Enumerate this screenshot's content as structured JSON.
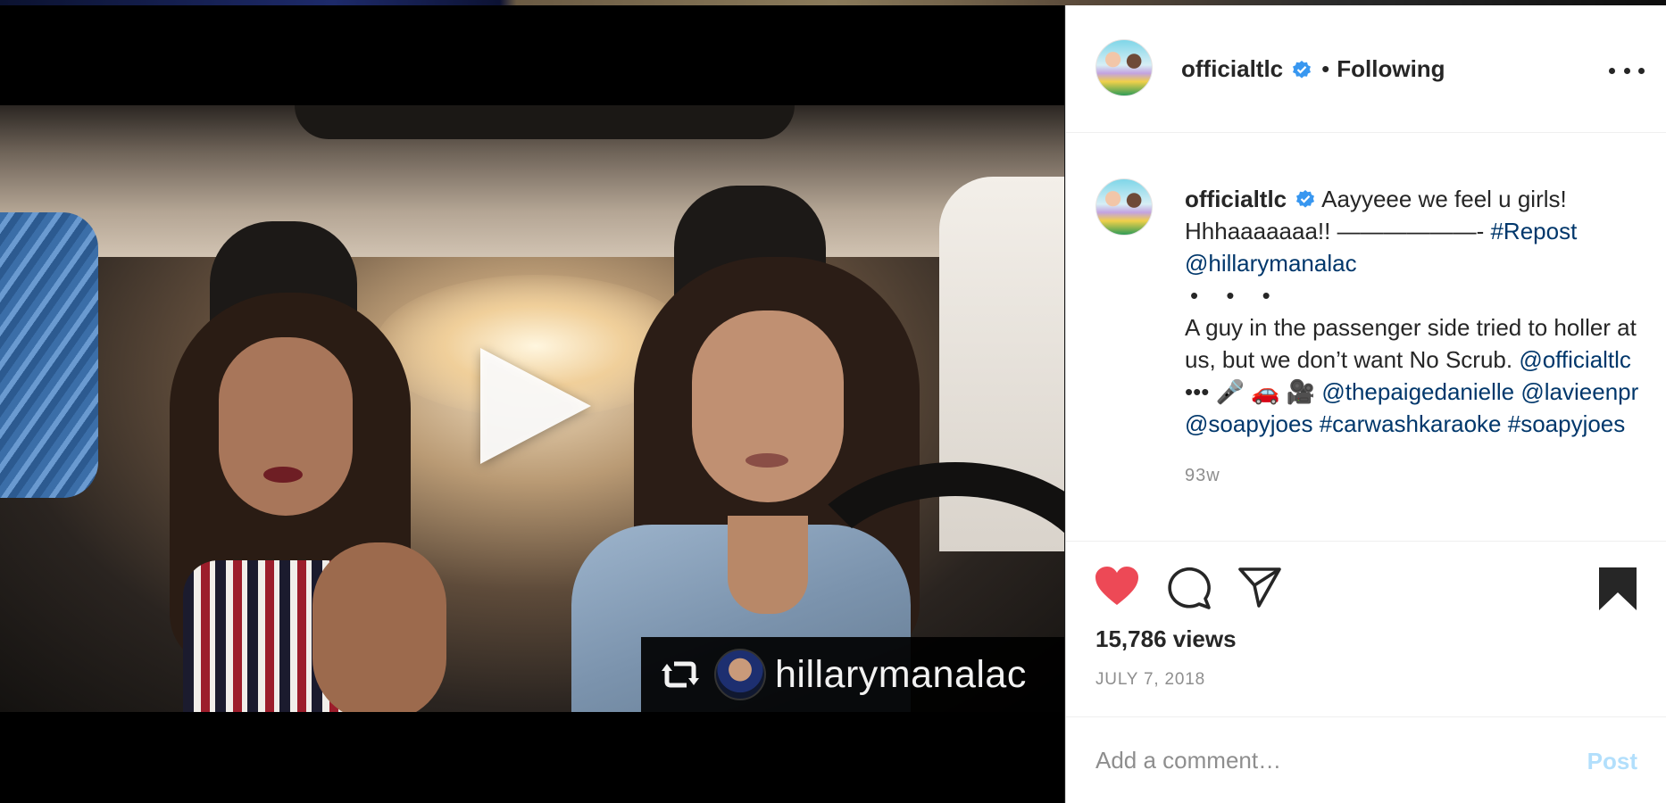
{
  "video": {
    "repost_username": "hillarymanalac",
    "repost_icon": "repost-icon",
    "play_icon": "play-icon"
  },
  "header": {
    "username": "officialtlc",
    "separator": "•",
    "follow_status": "Following",
    "more_icon": "more-options-icon"
  },
  "caption": {
    "username": "officialtlc",
    "intro": "Aayyeee we feel u girls! Hhhaaaaaaa!! ——————- ",
    "repost_tag": "#Repost",
    "repost_user": "@hillarymanalac",
    "dots": "• • •",
    "body": "A guy in the passenger side tried to holler at us, but we don’t want No Scrub. ",
    "mention_1": "@officialtlc",
    "emojis": " ••• 🎤 🚗 🎥",
    "mention_2": "@thepaigedanielle",
    "mention_3": "@lavieenpr",
    "mention_4": "@soapyjoes",
    "hashtag_1": "#carwashkaraoke",
    "hashtag_2": "#soapyjoes",
    "age": "93w"
  },
  "actions": {
    "like_icon": "heart-filled-icon",
    "comment_icon": "comment-icon",
    "share_icon": "share-icon",
    "save_icon": "bookmark-filled-icon",
    "views": "15,786 views",
    "date": "JULY 7, 2018"
  },
  "comment": {
    "placeholder": "Add a comment…",
    "post_label": "Post"
  },
  "colors": {
    "like": "#ed4956",
    "link": "#00376b",
    "verified": "#3897f0",
    "post_disabled": "#b2dffc"
  }
}
